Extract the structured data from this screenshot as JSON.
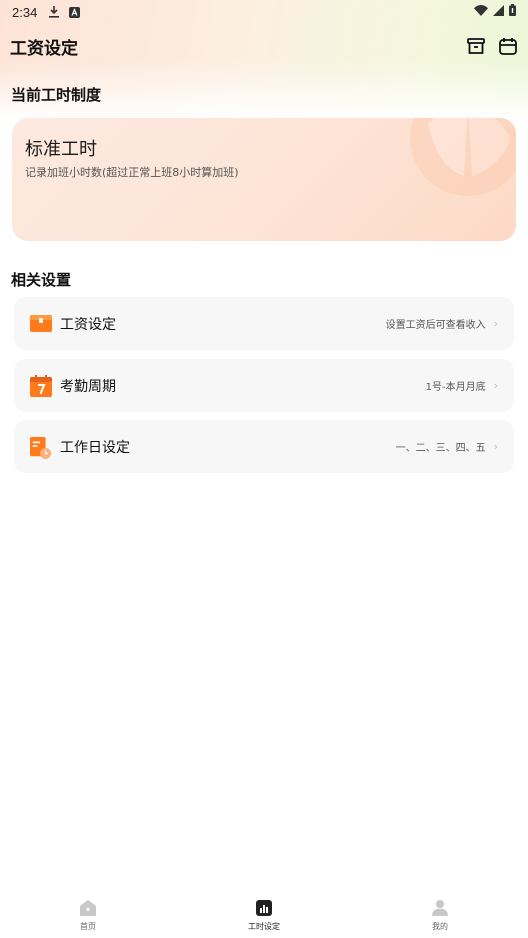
{
  "status_bar": {
    "time": "2:34"
  },
  "app_bar": {
    "title": "工资设定"
  },
  "current_system": {
    "section_title": "当前工时制度",
    "card_title": "标准工时",
    "card_desc": "记录加班小时数(超过正常上班8小时算加班)"
  },
  "related": {
    "section_title": "相关设置",
    "items": [
      {
        "label": "工资设定",
        "value": "设置工资后可查看收入",
        "icon": "wallet-icon"
      },
      {
        "label": "考勤周期",
        "value": "1号-本月月底",
        "icon": "calendar-icon"
      },
      {
        "label": "工作日设定",
        "value": "一、二、三、四、五",
        "icon": "workday-icon"
      }
    ]
  },
  "bottom_nav": {
    "tabs": [
      {
        "label": "首页",
        "icon": "home-icon",
        "active": false
      },
      {
        "label": "工时设定",
        "icon": "chart-icon",
        "active": true
      },
      {
        "label": "我的",
        "icon": "user-icon",
        "active": false
      }
    ]
  },
  "colors": {
    "accent": "#ff7a1a",
    "card_bg": "#f7f7f7"
  }
}
